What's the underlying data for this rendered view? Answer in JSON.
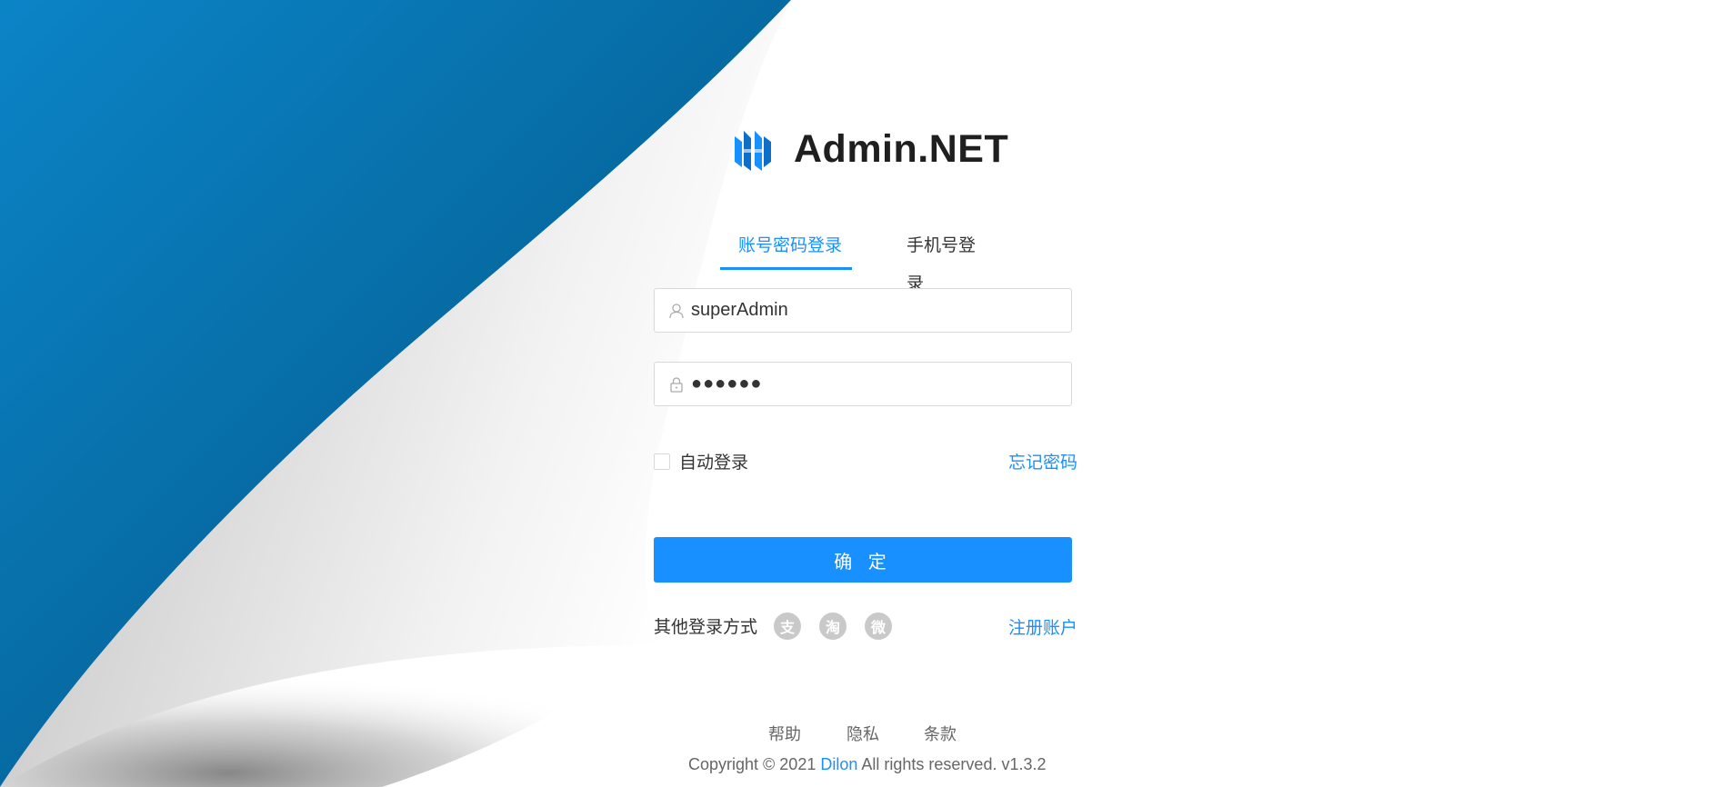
{
  "app": {
    "title": "Admin.NET",
    "logo_icon": "admin-net-logo-icon",
    "accent_color": "#1890ff"
  },
  "tabs": [
    {
      "label": "账号密码登录",
      "active": true
    },
    {
      "label": "手机号登录",
      "active": false
    }
  ],
  "form": {
    "username_value": "superAdmin",
    "username_icon": "user-icon",
    "password_value": "●●●●●●",
    "password_icon": "lock-icon",
    "remember_label": "自动登录",
    "remember_checked": false,
    "forgot_label": "忘记密码",
    "submit_label": "确 定"
  },
  "other_login": {
    "label": "其他登录方式",
    "providers": [
      {
        "name": "alipay-icon",
        "glyph": "支"
      },
      {
        "name": "taobao-icon",
        "glyph": "淘"
      },
      {
        "name": "weibo-icon",
        "glyph": "微"
      }
    ],
    "register_label": "注册账户"
  },
  "footer": {
    "links": [
      "帮助",
      "隐私",
      "条款"
    ],
    "copyright_prefix": "Copyright © 2021 ",
    "copyright_brand": "Dilon",
    "copyright_suffix": " All rights reserved. v1.3.2"
  }
}
